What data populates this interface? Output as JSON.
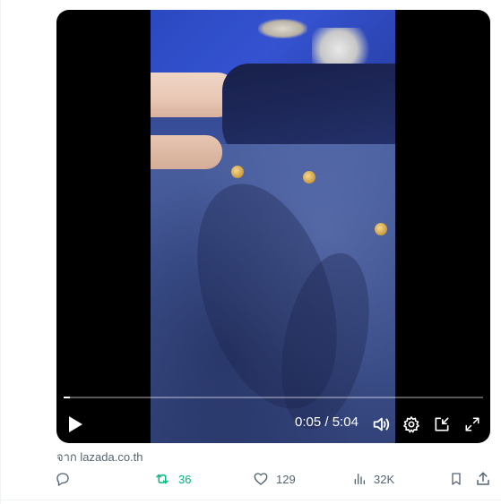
{
  "video": {
    "current_time": "0:05",
    "separator": "/",
    "duration": "5:04",
    "progress_fraction": 0.016
  },
  "post": {
    "source_text": "จาก lazada.co.th"
  },
  "actions": {
    "retweets": "36",
    "likes": "129",
    "views": "32K"
  },
  "colors": {
    "retweet_active": "#00ba7c",
    "muted": "#536471"
  },
  "icons": [
    "play-icon",
    "volume-icon",
    "settings-icon",
    "picture-in-picture-icon",
    "fullscreen-icon",
    "reply-icon",
    "retweet-icon",
    "like-icon",
    "views-icon",
    "bookmark-icon",
    "share-icon"
  ]
}
